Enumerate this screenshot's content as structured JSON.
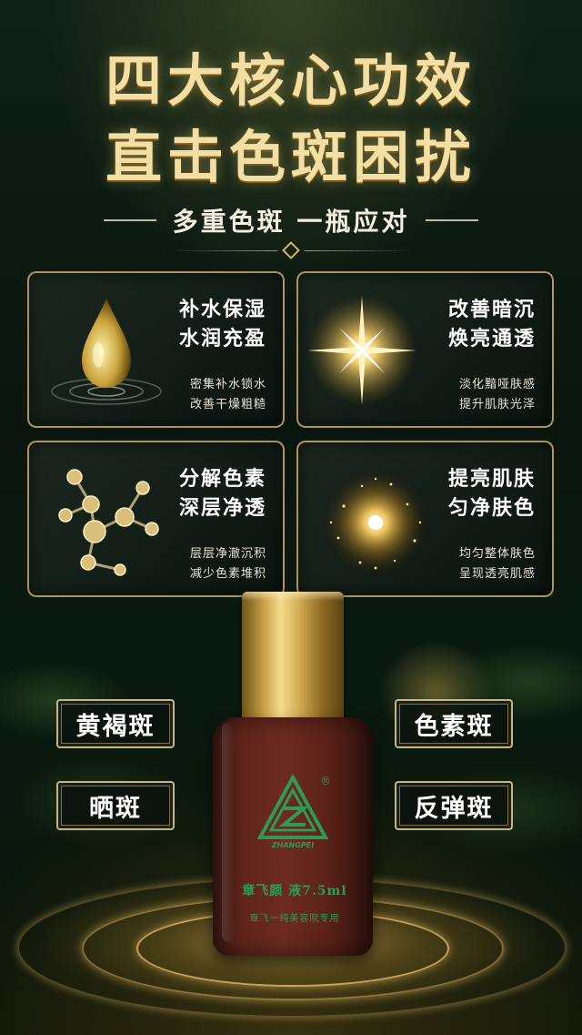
{
  "title": {
    "line1": "四大核心功效",
    "line2": "直击色斑困扰"
  },
  "subtitle": "多重色斑  一瓶应对",
  "cards": [
    {
      "headline": [
        "补水保湿",
        "水润充盈"
      ],
      "desc": [
        "密集补水锁水",
        "改善干燥粗糙"
      ],
      "icon": "water-droplet-icon"
    },
    {
      "headline": [
        "改善暗沉",
        "焕亮通透"
      ],
      "desc": [
        "淡化黯哑肤感",
        "提升肌肤光泽"
      ],
      "icon": "sparkle-star-icon"
    },
    {
      "headline": [
        "分解色素",
        "深层净透"
      ],
      "desc": [
        "层层净澈沉积",
        "减少色素堆积"
      ],
      "icon": "molecule-icon"
    },
    {
      "headline": [
        "提亮肌肤",
        "匀净肤色"
      ],
      "desc": [
        "均匀整体肤色",
        "呈现透亮肌感"
      ],
      "icon": "glitter-orb-icon"
    }
  ],
  "tags": [
    "黄褐斑",
    "色素斑",
    "晒斑",
    "反弹斑"
  ],
  "product": {
    "brand_en": "ZHANGPEI",
    "name_line": "章飞颜    液7.5ml",
    "usage_line": "章飞一纯美容院专用",
    "registered_mark": "®"
  },
  "colors": {
    "gold": "#f3dfa4",
    "card_border": "#dcbe78",
    "logo_green": "#2e9a55",
    "background": "#0b160e"
  }
}
